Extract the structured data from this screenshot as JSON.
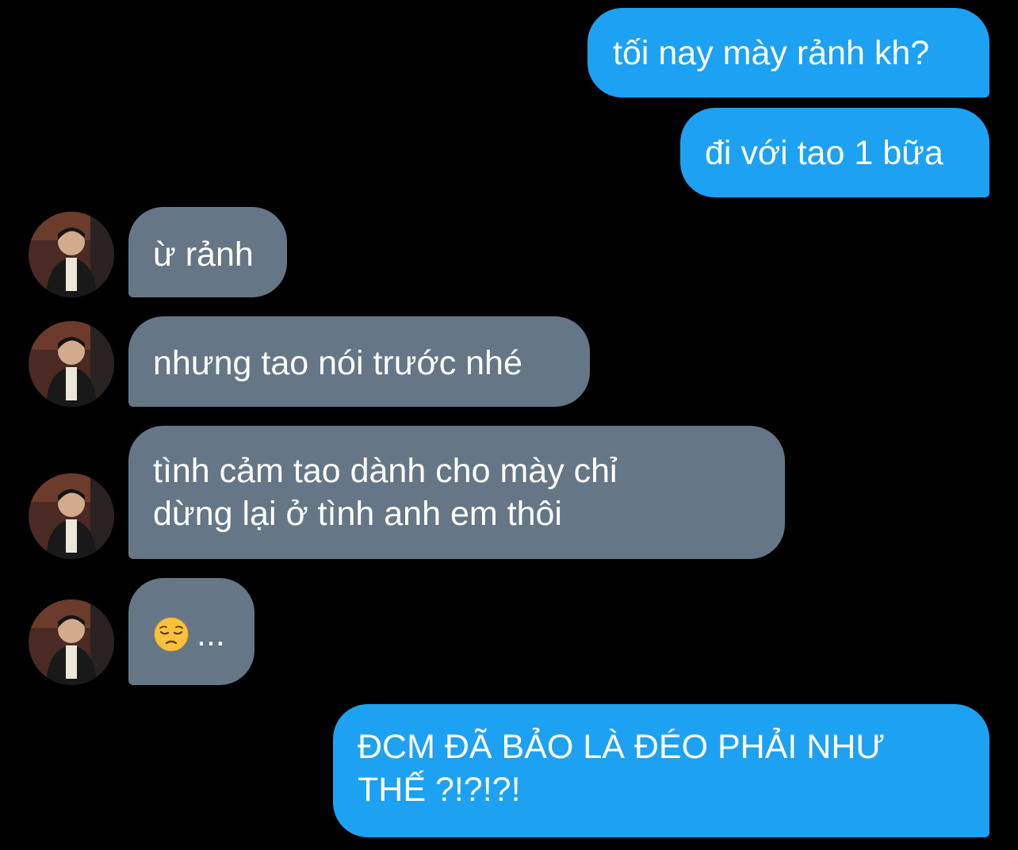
{
  "conversation": {
    "messages": [
      {
        "id": "m1",
        "direction": "sent",
        "text": "tối nay mày rảnh kh?"
      },
      {
        "id": "m2",
        "direction": "sent",
        "text": "đi với tao 1 bữa"
      },
      {
        "id": "m3",
        "direction": "received",
        "text": "ừ rảnh"
      },
      {
        "id": "m4",
        "direction": "received",
        "text": "nhưng tao nói trước nhé"
      },
      {
        "id": "m5",
        "direction": "received",
        "line1": "tình cảm tao dành cho mày chỉ",
        "line2": "dừng lại ở tình anh em thôi"
      },
      {
        "id": "m6",
        "direction": "received",
        "emoji": "pensive-face-icon",
        "text": "..."
      },
      {
        "id": "m7",
        "direction": "sent",
        "line1": "ĐCM ĐÃ BẢO LÀ ĐÉO PHẢI NHƯ",
        "line2": "THẾ ?!?!?!"
      }
    ]
  },
  "colors": {
    "background": "#000000",
    "sent_bubble": "#1da1f2",
    "received_bubble": "#657786",
    "text": "#ffffff"
  }
}
